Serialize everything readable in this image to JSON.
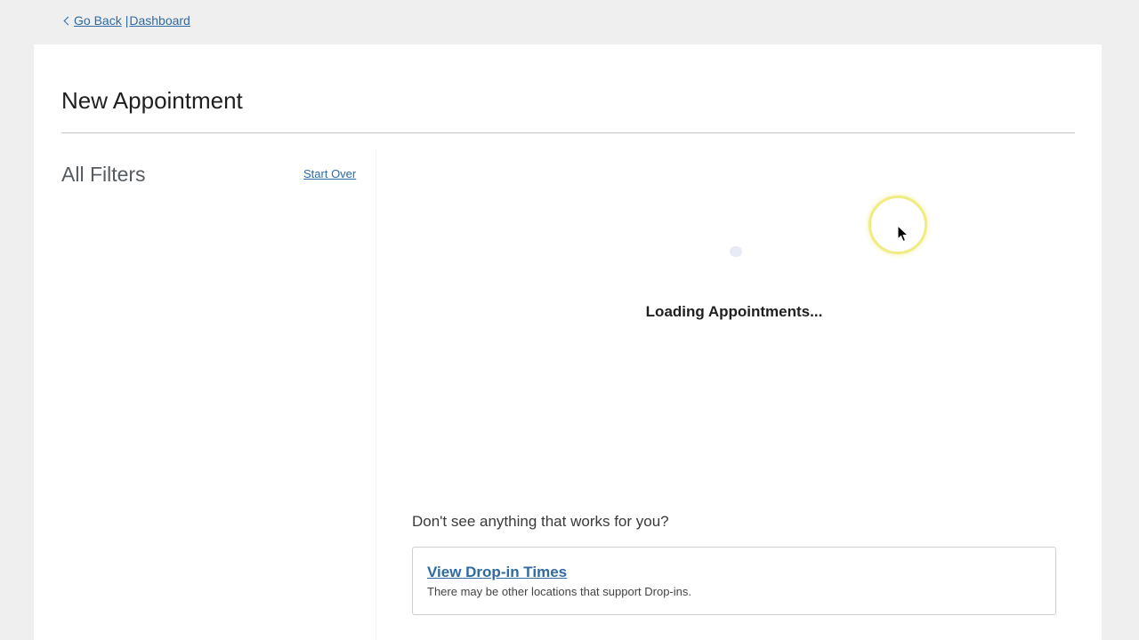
{
  "breadcrumb": {
    "go_back": "Go Back",
    "separator": "|",
    "dashboard": "Dashboard"
  },
  "page": {
    "title": "New Appointment"
  },
  "filters": {
    "title": "All Filters",
    "start_over": "Start Over"
  },
  "main": {
    "loading_text": "Loading Appointments...",
    "prompt": "Don't see anything that works for you?",
    "dropin": {
      "link": "View Drop-in Times",
      "description": "There may be other locations that support Drop-ins."
    }
  },
  "colors": {
    "link": "#2f6aa3",
    "background": "#efefef",
    "card": "#ffffff",
    "cursor_highlight": "#ebe65a"
  },
  "icons": {
    "back": "chevron-left-icon",
    "cursor": "mouse-pointer-icon"
  }
}
